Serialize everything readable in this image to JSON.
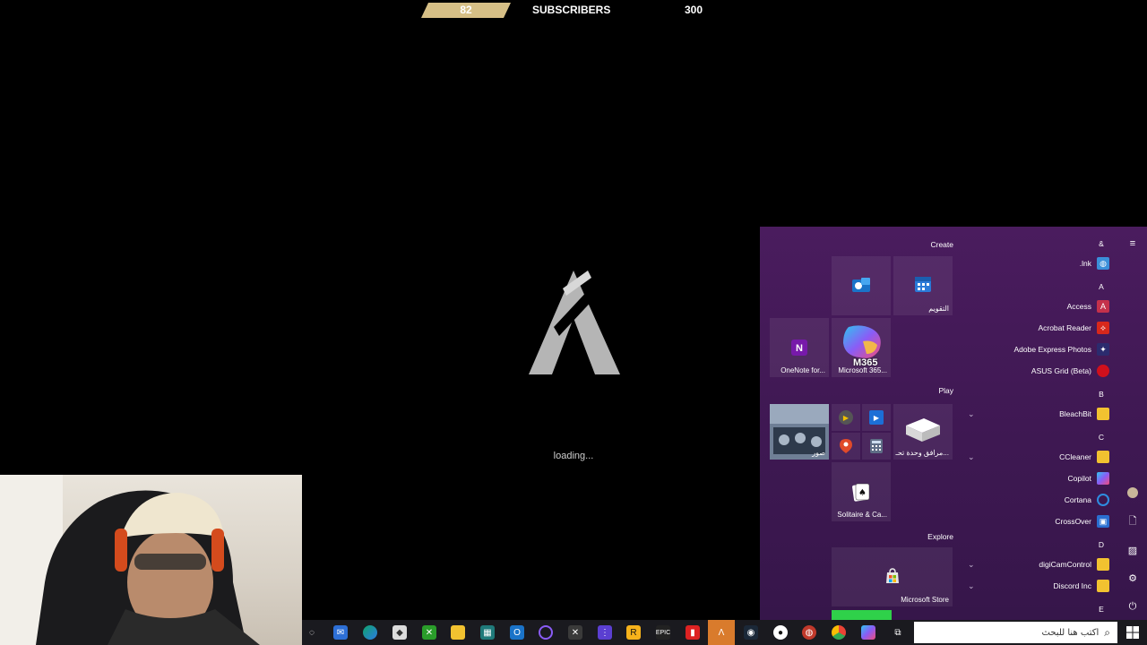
{
  "subscriber_bar": {
    "count": "82",
    "label": "SUBSCRIBERS",
    "goal": "300"
  },
  "loading": {
    "text": "loading..."
  },
  "start_menu": {
    "groups": {
      "create": "Create",
      "play": "Play",
      "explore": "Explore"
    },
    "tiles": {
      "outlook": "",
      "calendar": "التقويم",
      "onenote": "OneNote for...",
      "m365": "Microsoft 365...",
      "m365_badge": "M365",
      "photos": "صور",
      "companion": "مرافق وحدة تحـ...",
      "solitaire": "Solitaire & Ca...",
      "store": "Microsoft Store"
    },
    "app_list": [
      {
        "kind": "letter",
        "text": "&"
      },
      {
        "kind": "app",
        "name": ".lnk",
        "icon": "globe-icon",
        "color": "#3b8fd9"
      },
      {
        "kind": "letter",
        "text": "A"
      },
      {
        "kind": "app",
        "name": "Access",
        "icon": "access-icon",
        "color": "#c4314b"
      },
      {
        "kind": "app",
        "name": "Acrobat Reader",
        "icon": "acrobat-icon",
        "color": "#d7281b"
      },
      {
        "kind": "app",
        "name": "Adobe Express Photos",
        "icon": "express-icon",
        "color": "#2b2b6e"
      },
      {
        "kind": "app",
        "name": "ASUS Grid (Beta)",
        "icon": "asus-icon",
        "color": "#d0101c"
      },
      {
        "kind": "letter",
        "text": "B"
      },
      {
        "kind": "app",
        "name": "BleachBit",
        "icon": "folder-icon",
        "color": "#f2c230"
      },
      {
        "kind": "letter",
        "text": "C"
      },
      {
        "kind": "app",
        "name": "CCleaner",
        "icon": "folder-icon",
        "color": "#f2c230"
      },
      {
        "kind": "app",
        "name": "Copilot",
        "icon": "copilot-icon",
        "color": "#7a5cf0"
      },
      {
        "kind": "app",
        "name": "Cortana",
        "icon": "cortana-icon",
        "color": "#2e8de0"
      },
      {
        "kind": "app",
        "name": "CrossOver",
        "icon": "crossover-icon",
        "color": "#2a6fd1"
      },
      {
        "kind": "letter",
        "text": "D"
      },
      {
        "kind": "app",
        "name": "digiCamControl",
        "icon": "folder-icon",
        "color": "#f2c230"
      },
      {
        "kind": "app",
        "name": "Discord Inc",
        "icon": "folder-icon",
        "color": "#f2c230"
      },
      {
        "kind": "letter",
        "text": "E"
      }
    ]
  },
  "taskbar": {
    "search_placeholder": "أكتب هنا للبحث",
    "icons": [
      "task-view-icon",
      "mail-icon",
      "edge-icon",
      "app-icon",
      "xbox-icon",
      "file-explorer-icon",
      "steam-deck-icon",
      "outlook-icon",
      "cortana-icon",
      "excel-icon",
      "apps-grid-icon",
      "rockstar-icon",
      "epic-games-icon",
      "fasting-icon",
      "fivem-icon",
      "steam-icon",
      "obs-icon",
      "camera-icon",
      "chrome-icon",
      "copilot-icon",
      "timeline-icon"
    ]
  }
}
